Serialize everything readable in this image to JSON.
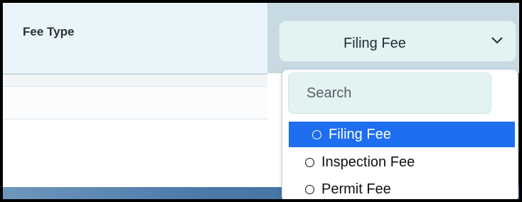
{
  "field": {
    "label": "Fee Type"
  },
  "select": {
    "value": "Filing Fee",
    "icon": "chevron-down-icon"
  },
  "dropdown": {
    "search_placeholder": "Search",
    "options": [
      {
        "label": "Filing Fee",
        "selected": true
      },
      {
        "label": "Inspection Fee",
        "selected": false
      },
      {
        "label": "Permit Fee",
        "selected": false
      }
    ]
  },
  "colors": {
    "highlight": "#1e6ff0",
    "label_bg": "#eaf5fb",
    "select_cell_bg": "#c7d9e3",
    "select_box_bg": "#e3f3f2"
  }
}
